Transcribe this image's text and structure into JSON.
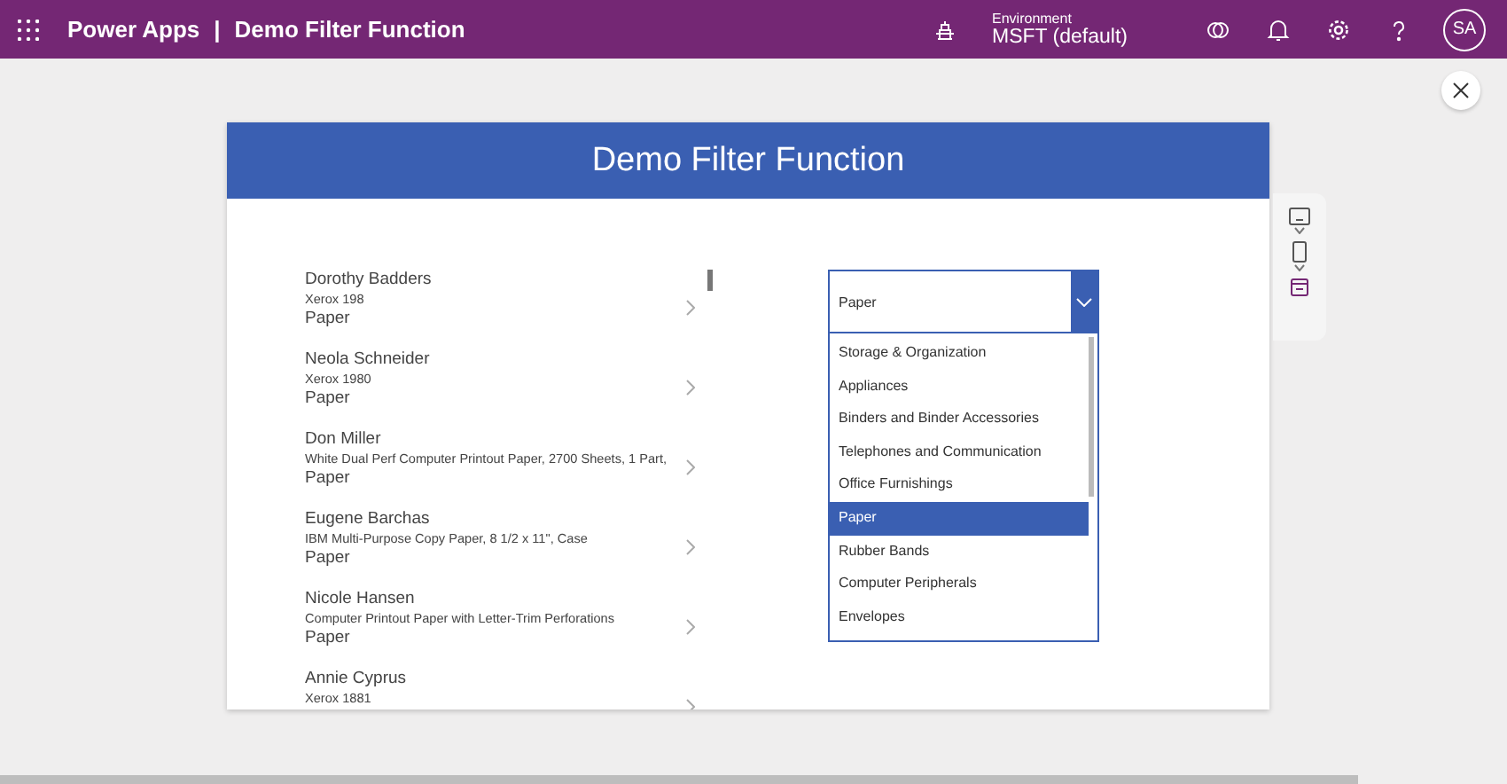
{
  "header": {
    "app_name": "Power Apps",
    "separator": "|",
    "app_title": "Demo Filter Function",
    "environment_label": "Environment",
    "environment_value": "MSFT (default)",
    "avatar": "SA"
  },
  "screen": {
    "title": "Demo Filter Function",
    "gallery": [
      {
        "name": "Dorothy Badders",
        "product": "Xerox 198",
        "category": "Paper"
      },
      {
        "name": "Neola Schneider",
        "product": "Xerox 1980",
        "category": "Paper"
      },
      {
        "name": "Don Miller",
        "product": "White Dual Perf Computer Printout Paper, 2700 Sheets, 1 Part,",
        "category": "Paper"
      },
      {
        "name": "Eugene Barchas",
        "product": "IBM Multi-Purpose Copy Paper, 8 1/2 x 11\", Case",
        "category": "Paper"
      },
      {
        "name": "Nicole Hansen",
        "product": "Computer Printout Paper with Letter-Trim Perforations",
        "category": "Paper"
      },
      {
        "name": "Annie Cyprus",
        "product": "Xerox 1881"
      }
    ],
    "dropdown": {
      "value": "Paper",
      "expanded": true,
      "options": [
        {
          "label": "Storage & Organization",
          "selected": false
        },
        {
          "label": "Appliances",
          "selected": false
        },
        {
          "label": "Binders and Binder Accessories",
          "selected": false
        },
        {
          "label": "Telephones and Communication",
          "selected": false
        },
        {
          "label": "Office Furnishings",
          "selected": false
        },
        {
          "label": "Paper",
          "selected": true
        },
        {
          "label": "Rubber Bands",
          "selected": false
        },
        {
          "label": "Computer Peripherals",
          "selected": false
        },
        {
          "label": "Envelopes",
          "selected": false
        }
      ]
    }
  }
}
